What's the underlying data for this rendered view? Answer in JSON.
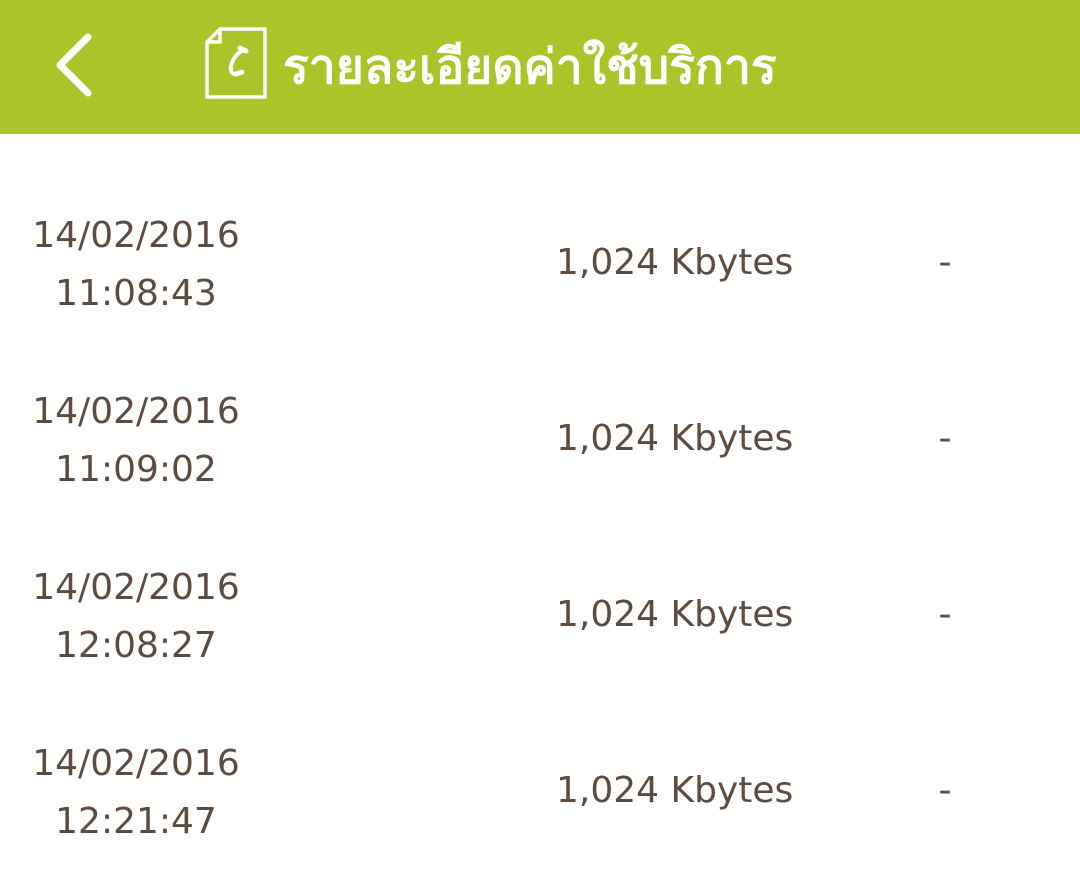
{
  "header": {
    "title": "รายละเอียดค่าใช้บริการ",
    "back_icon": "chevron-left-icon",
    "title_icon": "phone-document-icon",
    "background_color": "#aac42a"
  },
  "records": [
    {
      "date": "14/02/2016",
      "time": "11:08:43",
      "usage": "1,024 Kbytes",
      "charge": "-"
    },
    {
      "date": "14/02/2016",
      "time": "11:09:02",
      "usage": "1,024 Kbytes",
      "charge": "-"
    },
    {
      "date": "14/02/2016",
      "time": "12:08:27",
      "usage": "1,024 Kbytes",
      "charge": "-"
    },
    {
      "date": "14/02/2016",
      "time": "12:21:47",
      "usage": "1,024 Kbytes",
      "charge": "-"
    }
  ],
  "colors": {
    "text": "#5e4b3f",
    "header_text": "#ffffff"
  }
}
